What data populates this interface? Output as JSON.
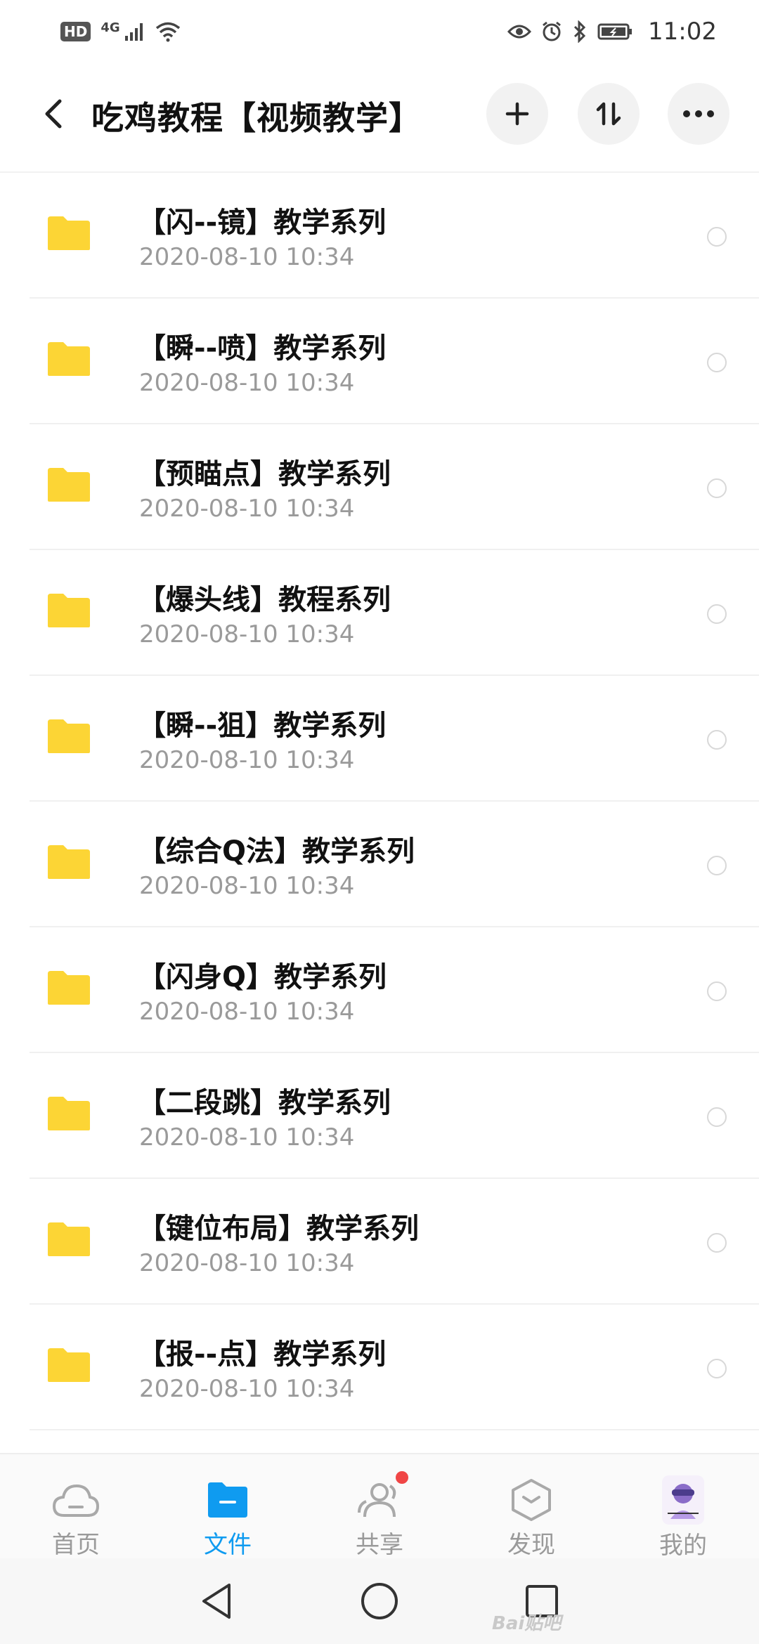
{
  "status_bar": {
    "hd": "HD",
    "network": "4G",
    "time": "11:02"
  },
  "header": {
    "title": "吃鸡教程【视频教学】",
    "icons": [
      "back-arrow-icon",
      "plus-icon",
      "sort-icon",
      "more-icon"
    ]
  },
  "files": [
    {
      "name": "【闪--镜】教学系列",
      "date": "2020-08-10  10:34"
    },
    {
      "name": "【瞬--喷】教学系列",
      "date": "2020-08-10  10:34"
    },
    {
      "name": "【预瞄点】教学系列",
      "date": "2020-08-10  10:34"
    },
    {
      "name": "【爆头线】教程系列",
      "date": "2020-08-10  10:34"
    },
    {
      "name": "【瞬--狙】教学系列",
      "date": "2020-08-10  10:34"
    },
    {
      "name": "【综合Q法】教学系列",
      "date": "2020-08-10  10:34"
    },
    {
      "name": "【闪身Q】教学系列",
      "date": "2020-08-10  10:34"
    },
    {
      "name": "【二段跳】教学系列",
      "date": "2020-08-10  10:34"
    },
    {
      "name": "【键位布局】教学系列",
      "date": "2020-08-10  10:34"
    },
    {
      "name": "【报--点】教学系列",
      "date": "2020-08-10  10:34"
    }
  ],
  "tabs": [
    {
      "label": "首页",
      "icon": "cloud-icon"
    },
    {
      "label": "文件",
      "icon": "folder-icon"
    },
    {
      "label": "共享",
      "icon": "people-icon"
    },
    {
      "label": "发现",
      "icon": "discover-icon"
    },
    {
      "label": "我的",
      "icon": "avatar"
    }
  ],
  "active_tab": "文件",
  "colors": {
    "accent": "#0f9bf0",
    "folder": "#fcd535",
    "badge": "#f04646"
  },
  "watermark": "Bai贴吧"
}
